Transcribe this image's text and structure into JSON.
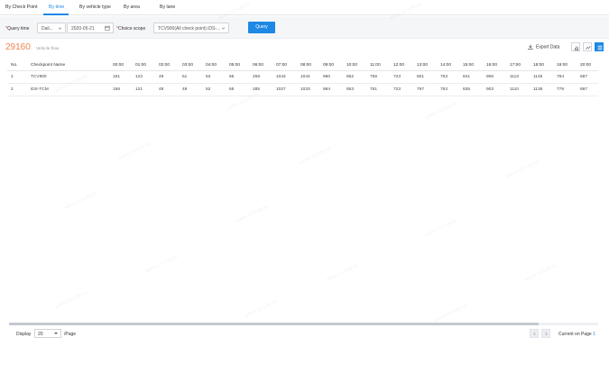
{
  "tabs": [
    "By Check Point",
    "By time",
    "By vehicle type",
    "By area",
    "By lane"
  ],
  "active_tab": 1,
  "query": {
    "query_time_label": "Query time",
    "period_value": "Dail...",
    "date_value": "2020-05-21",
    "scope_label": "Choice scope",
    "scope_value": "TCV900(All check point) iDS-...",
    "query_button": "Query"
  },
  "summary": {
    "total": "29160",
    "total_label": "Vehicle flow"
  },
  "toolbar": {
    "export_label": "Export Data",
    "view_buttons": [
      "bar-chart-icon",
      "line-chart-icon",
      "table-icon"
    ]
  },
  "table": {
    "columns": [
      "No.",
      "Checkpoint Name",
      "00:00",
      "01:00",
      "02:00",
      "03:00",
      "04:00",
      "05:00",
      "06:00",
      "07:00",
      "08:00",
      "09:00",
      "10:00",
      "11:00",
      "12:00",
      "13:00",
      "14:00",
      "15:00",
      "16:00",
      "17:00",
      "18:00",
      "19:00",
      "20:00"
    ],
    "rows": [
      [
        "1",
        "TCV900",
        "161",
        "122",
        "49",
        "51",
        "53",
        "66",
        "258",
        "1044",
        "1044",
        "960",
        "862",
        "756",
        "723",
        "801",
        "753",
        "841",
        "906",
        "1113",
        "1146",
        "784",
        "687"
      ],
      [
        "2",
        "iDS-TCM",
        "156",
        "121",
        "48",
        "49",
        "52",
        "65",
        "285",
        "1027",
        "1033",
        "984",
        "853",
        "751",
        "723",
        "797",
        "753",
        "835",
        "903",
        "1110",
        "1135",
        "778",
        "687"
      ]
    ]
  },
  "pagination": {
    "display_label": "Display",
    "page_size": "20",
    "per_page_label": "/Page",
    "current_label": "Current on Page",
    "current_page": "1"
  },
  "watermark_text": "admin 10.9.99.56",
  "colors": {
    "accent": "#1e88e5",
    "total": "#f2834e"
  }
}
